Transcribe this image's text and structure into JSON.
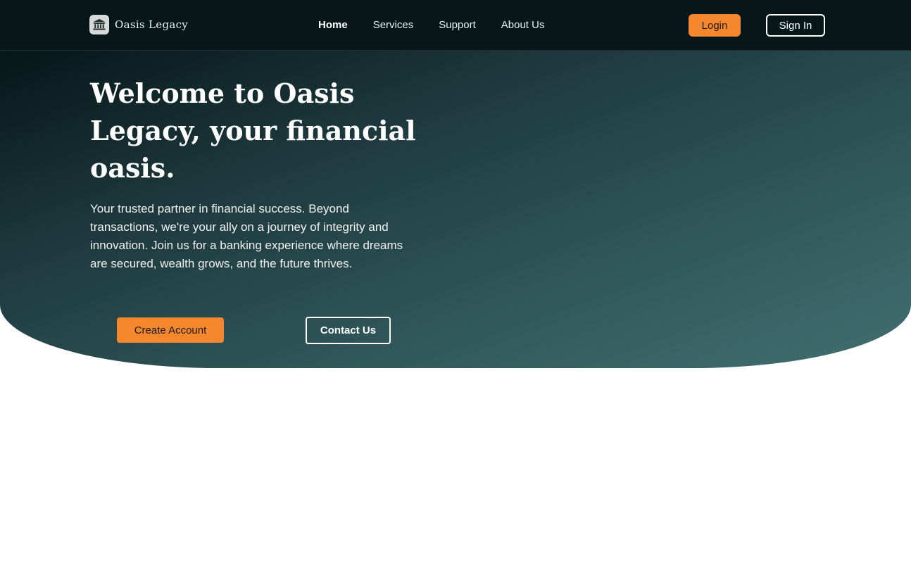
{
  "brand": {
    "name": "Oasis Legacy",
    "icon": "bank-icon"
  },
  "nav": {
    "items": [
      {
        "label": "Home",
        "active": true
      },
      {
        "label": "Services",
        "active": false
      },
      {
        "label": "Support",
        "active": false
      },
      {
        "label": "About Us",
        "active": false
      }
    ]
  },
  "header": {
    "login_label": "Login",
    "signin_label": "Sign In"
  },
  "hero": {
    "title": "Welcome to Oasis Legacy, your financial oasis.",
    "text": "Your trusted partner in financial success. Beyond transactions, we're your ally on a journey of integrity and innovation. Join us for a banking experience where dreams are secured, wealth grows, and the future thrives.",
    "create_account_label": "Create Account",
    "contact_label": "Contact Us"
  },
  "colors": {
    "accent": "#f5882f",
    "header_bg": "#061619",
    "hero_dark": "#061619",
    "hero_light": "#426f71"
  }
}
